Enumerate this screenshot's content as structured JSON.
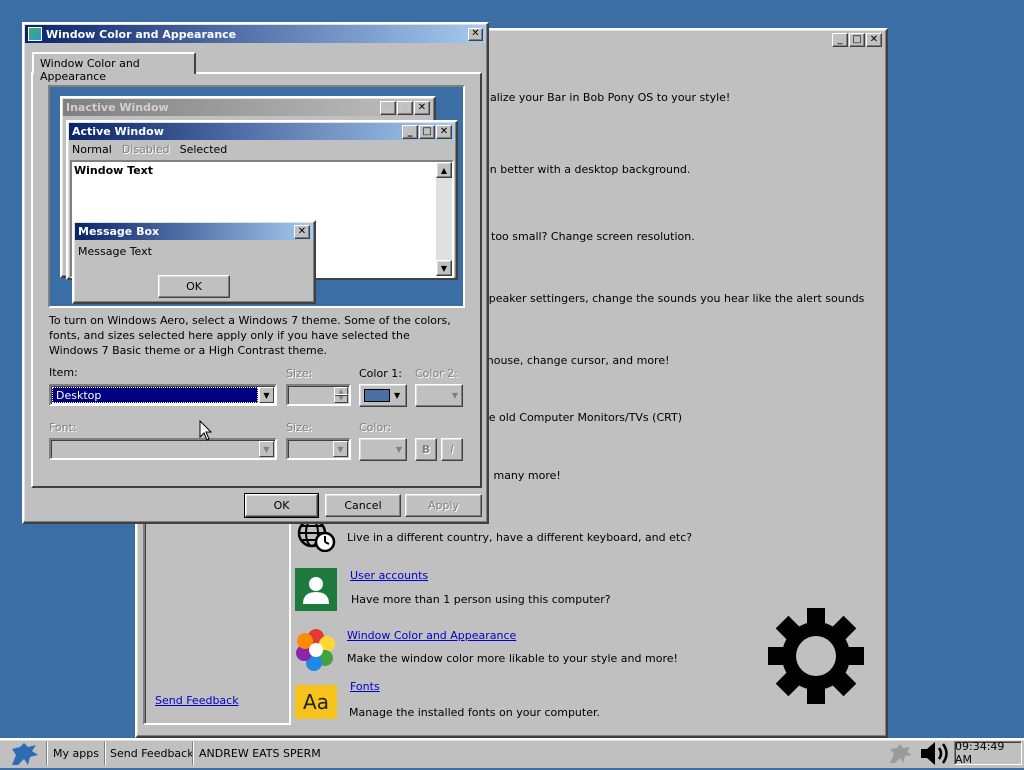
{
  "control_panel": {
    "rows": [
      {
        "desc": "nalize your Bar in Bob Pony OS to your style!"
      },
      {
        "desc": "en better with a desktop background."
      },
      {
        "desc": "r too small? Change screen resolution."
      },
      {
        "desc": "speaker settingers, change the sounds you hear like the alert sounds"
      },
      {
        "desc": "mouse, change cursor, and more!"
      },
      {
        "desc": "se old Computer Monitors/TVs (CRT)"
      },
      {
        "desc": "d many more!"
      },
      {
        "desc": "Live in a different country, have a different keyboard, and etc?"
      }
    ],
    "user_accounts": {
      "link": "User accounts",
      "desc": "Have more than 1 person using this computer?"
    },
    "window_color": {
      "link": "Window Color and Appearance",
      "desc": "Make the window color more likable to your style and more!"
    },
    "fonts": {
      "link": "Fonts",
      "desc": "Manage the installed fonts on your computer."
    },
    "fonts_icon_text": "Aa",
    "send_feedback": "Send Feedback"
  },
  "dialog": {
    "title": "Window Color and Appearance",
    "tab_label": "Window Color and Appearance",
    "preview": {
      "inactive_title": "Inactive Window",
      "active_title": "Active Window",
      "menu": [
        "Normal",
        "Disabled",
        "Selected"
      ],
      "window_text": "Window Text",
      "msgbox_title": "Message Box",
      "msgbox_text": "Message Text",
      "msgbox_ok": "OK"
    },
    "info_text": "To turn on Windows Aero, select a Windows 7 theme.  Some of the colors, fonts, and sizes selected here apply only if you have selected the Windows 7 Basic theme or a High Contrast theme.",
    "item_label": "Item:",
    "item_value": "Desktop",
    "size_label": "Size:",
    "color1_label": "Color 1:",
    "color2_label": "Color 2:",
    "font_label": "Font:",
    "size2_label": "Size:",
    "color_label": "Color:",
    "bold_label": "B",
    "italic_label": "I",
    "ok": "OK",
    "cancel": "Cancel",
    "apply": "Apply",
    "selected_color": "#4a6fa5"
  },
  "taskbar": {
    "my_apps": "My apps",
    "send_feedback": "Send Feedback",
    "window_item": "ANDREW EATS SPERM",
    "clock": "09:34:49 AM"
  }
}
